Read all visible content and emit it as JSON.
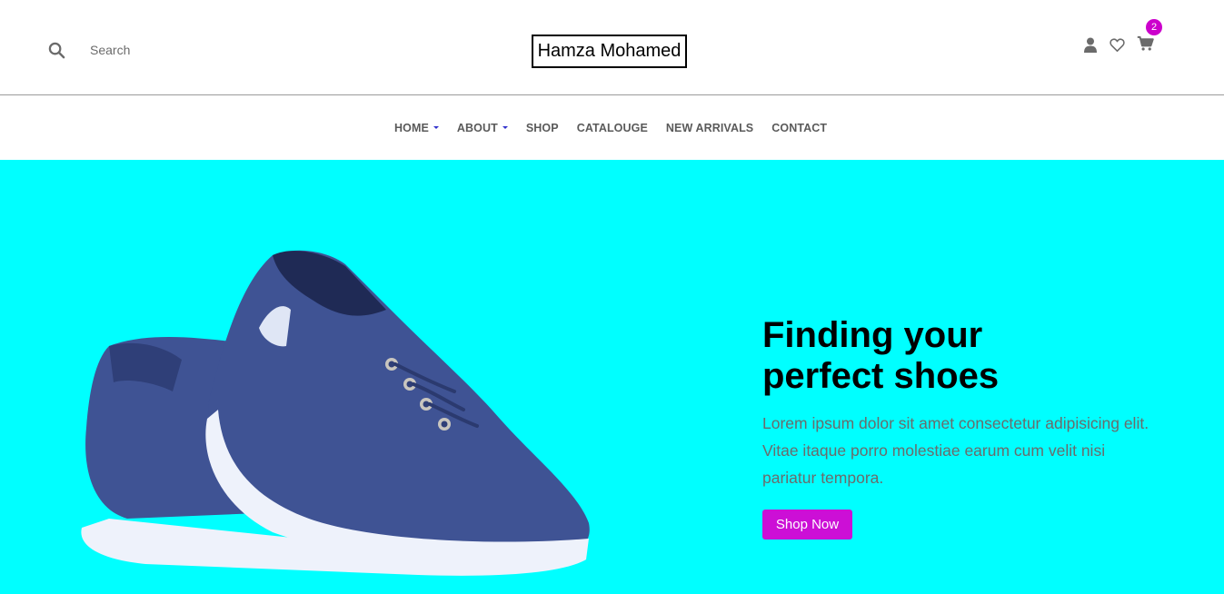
{
  "header": {
    "search": {
      "placeholder": "Search",
      "value": ""
    },
    "logo": "Hamza Mohamed",
    "cart_count": "2"
  },
  "nav": {
    "items": [
      {
        "label": "HOME",
        "dropdown": true
      },
      {
        "label": "ABOUT",
        "dropdown": true
      },
      {
        "label": "SHOP",
        "dropdown": false
      },
      {
        "label": "CATALOUGE",
        "dropdown": false
      },
      {
        "label": "NEW ARRIVALS",
        "dropdown": false
      },
      {
        "label": "CONTACT",
        "dropdown": false
      }
    ]
  },
  "hero": {
    "title_line1": "Finding your",
    "title_line2": "perfect shoes",
    "description": "Lorem ipsum dolor sit amet consectetur adipisicing elit. Vitae itaque porro molestiae earum cum velit nisi pariatur tempora.",
    "cta_label": "Shop Now",
    "background": "#00ffff"
  },
  "colors": {
    "accent": "#cc0fd6",
    "nav_caret": "#3333cc",
    "shoe_blue": "#3f5394"
  },
  "icons": [
    "search-icon",
    "user-icon",
    "heart-icon",
    "cart-icon"
  ]
}
